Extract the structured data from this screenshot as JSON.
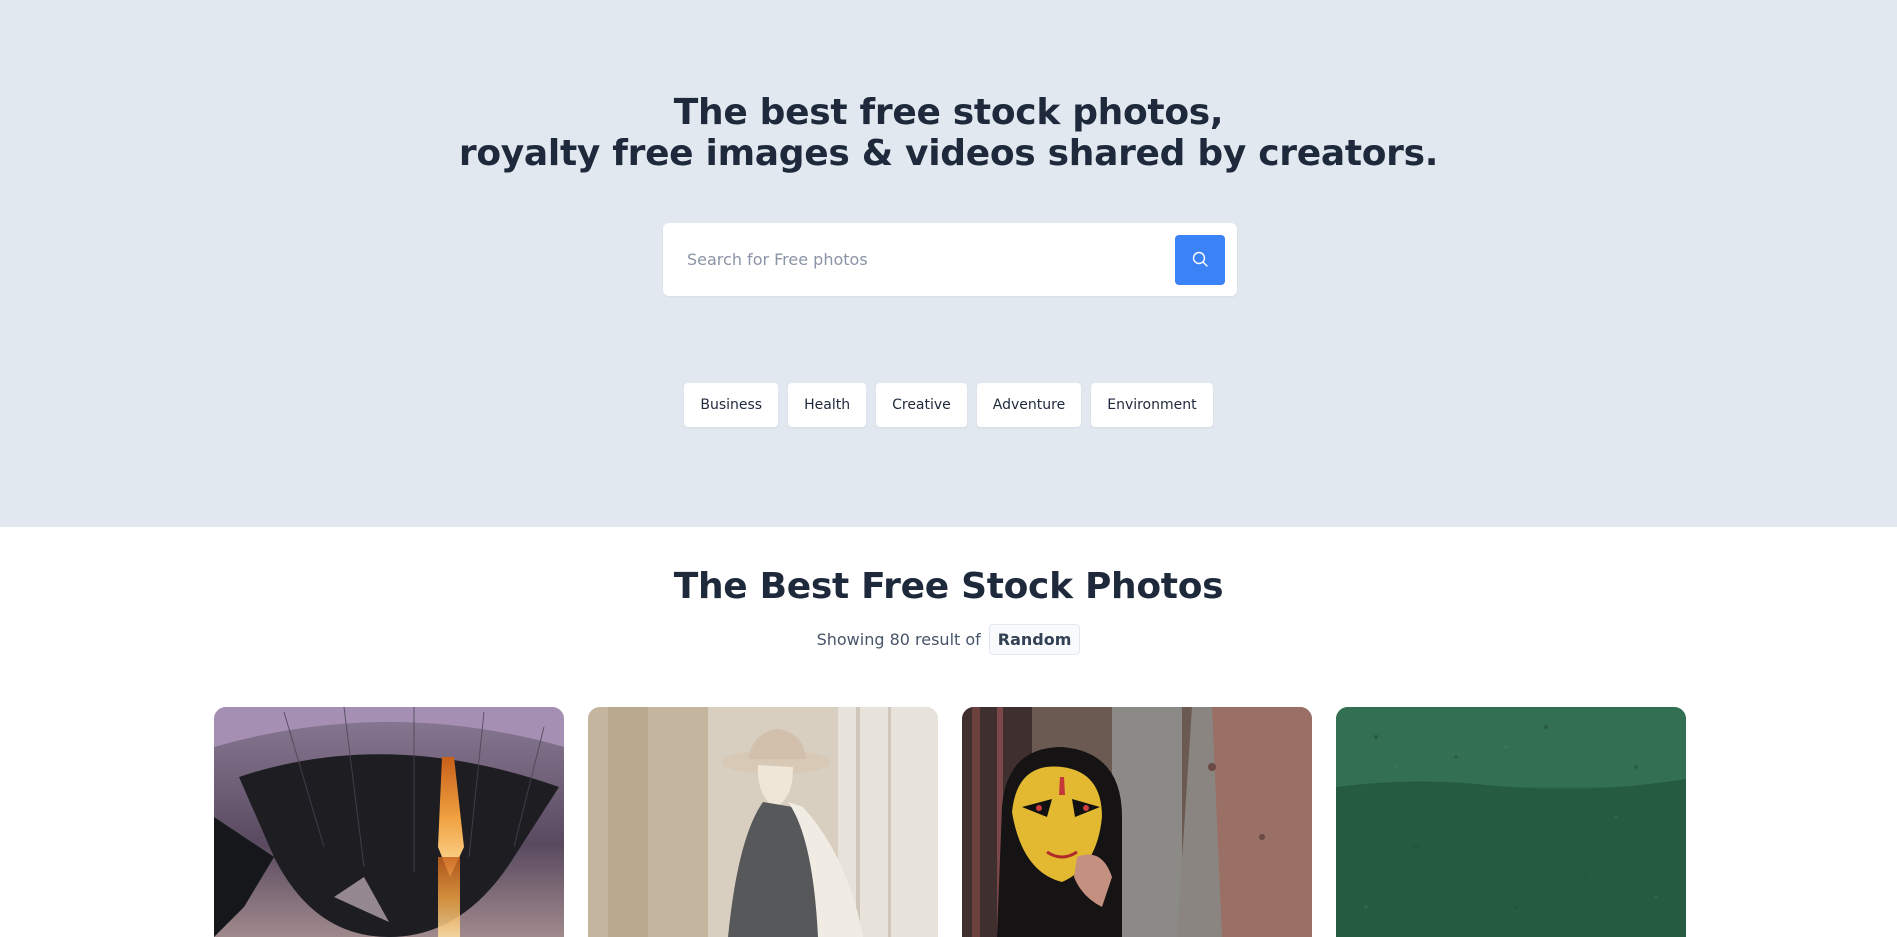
{
  "hero": {
    "title_line1": "The best free stock photos,",
    "title_line2": "royalty free images & videos shared by creators."
  },
  "search": {
    "placeholder": "Search for Free photos",
    "value": "",
    "button_icon": "search-icon"
  },
  "tags": [
    "Business",
    "Health",
    "Creative",
    "Adventure",
    "Environment"
  ],
  "section": {
    "title": "The Best Free Stock Photos",
    "result_prefix": "Showing 80 result of",
    "result_category": "Random"
  },
  "photos": [
    {
      "subject": "hot-air-balloon"
    },
    {
      "subject": "woman-in-hat"
    },
    {
      "subject": "person-with-mask"
    },
    {
      "subject": "green-wall"
    }
  ],
  "colors": {
    "hero_background": "#e2e8f0",
    "accent": "#3b82f6",
    "heading": "#1e293b"
  }
}
